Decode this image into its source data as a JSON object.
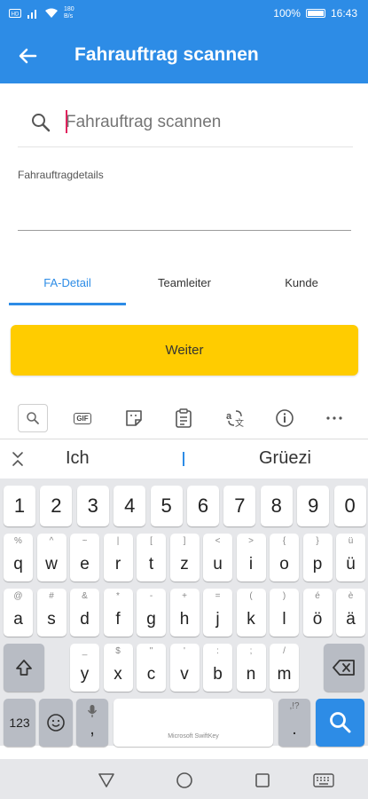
{
  "status_bar": {
    "net_speed": "180\nB/s",
    "battery": "100%",
    "time": "16:43"
  },
  "app_bar": {
    "title": "Fahrauftrag scannen",
    "back_icon": "arrow-left-icon"
  },
  "search": {
    "value": "",
    "placeholder": "Fahrauftrag scannen",
    "icon": "search-icon"
  },
  "details": {
    "label": "Fahrauftragdetails"
  },
  "tabs": [
    {
      "label": "FA-Detail",
      "active": true
    },
    {
      "label": "Teamleiter",
      "active": false
    },
    {
      "label": "Kunde",
      "active": false
    }
  ],
  "weiter_button": {
    "label": "Weiter",
    "color": "#ffcc00"
  },
  "keyboard": {
    "brand": "Microsoft SwiftKey",
    "suggestions": [
      "Ich",
      "Grüezi"
    ],
    "number_row": [
      "1",
      "2",
      "3",
      "4",
      "5",
      "6",
      "7",
      "8",
      "9",
      "0"
    ],
    "row1": [
      {
        "hint": "%",
        "key": "q"
      },
      {
        "hint": "^",
        "key": "w"
      },
      {
        "hint": "~",
        "key": "e"
      },
      {
        "hint": "|",
        "key": "r"
      },
      {
        "hint": "[",
        "key": "t"
      },
      {
        "hint": "]",
        "key": "z"
      },
      {
        "hint": "<",
        "key": "u"
      },
      {
        "hint": ">",
        "key": "i"
      },
      {
        "hint": "{",
        "key": "o"
      },
      {
        "hint": "}",
        "key": "p"
      },
      {
        "hint": "ü",
        "key": "ü"
      }
    ],
    "row2": [
      {
        "hint": "@",
        "key": "a"
      },
      {
        "hint": "#",
        "key": "s"
      },
      {
        "hint": "&",
        "key": "d"
      },
      {
        "hint": "*",
        "key": "f"
      },
      {
        "hint": "-",
        "key": "g"
      },
      {
        "hint": "+",
        "key": "h"
      },
      {
        "hint": "=",
        "key": "j"
      },
      {
        "hint": "(",
        "key": "k"
      },
      {
        "hint": ")",
        "key": "l"
      },
      {
        "hint": "é",
        "key": "ö"
      },
      {
        "hint": "è",
        "key": "ä"
      }
    ],
    "row3": [
      {
        "hint": "_",
        "key": "y"
      },
      {
        "hint": "$",
        "key": "x"
      },
      {
        "hint": "\"",
        "key": "c"
      },
      {
        "hint": "'",
        "key": "v"
      },
      {
        "hint": ":",
        "key": "b"
      },
      {
        "hint": ";",
        "key": "n"
      },
      {
        "hint": "/",
        "key": "m"
      }
    ],
    "bottom": {
      "symbols": "123",
      "emoji_icon": "smiley-icon",
      "mic_icon": "microphone-icon",
      "mic_key": ",",
      "period_hint": ",!?",
      "period_key": ".",
      "search_key_icon": "search-icon"
    },
    "accent_color": "#2d8ce6"
  },
  "nav_bar": {
    "back_icon": "triangle-back-icon",
    "home_icon": "circle-home-icon",
    "recents_icon": "square-recents-icon",
    "keyboard_icon": "keyboard-hide-icon"
  }
}
